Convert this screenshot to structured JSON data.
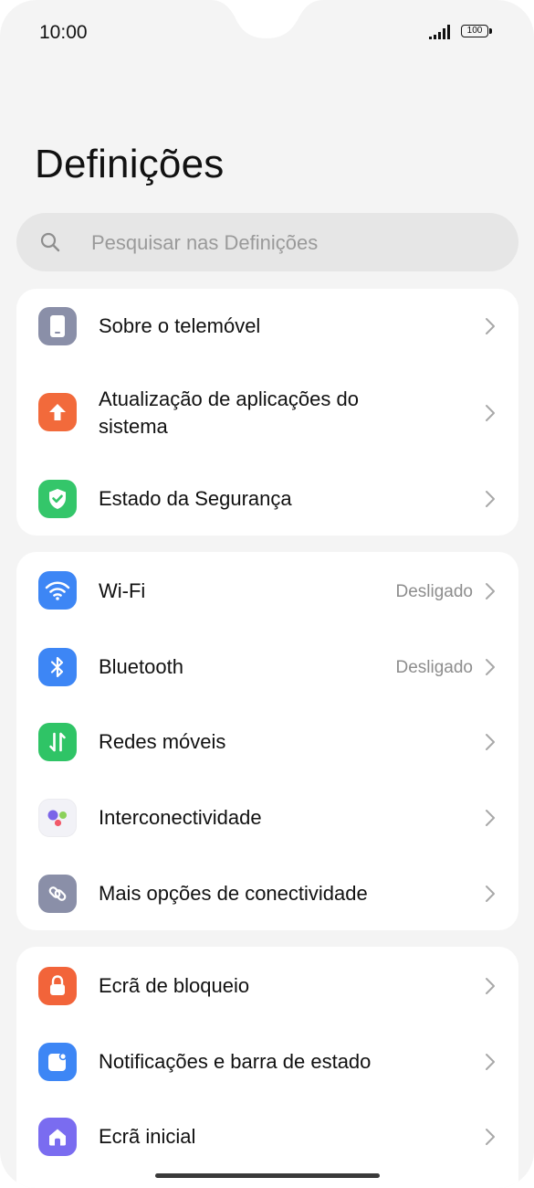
{
  "status_bar": {
    "time": "10:00",
    "battery": "100"
  },
  "page": {
    "title": "Definições"
  },
  "search": {
    "placeholder": "Pesquisar nas Definições"
  },
  "groups": [
    {
      "items": [
        {
          "label": "Sobre o telemóvel",
          "icon": "phone-icon",
          "icon_color": "#8a8fa8"
        },
        {
          "label_line1": "Atualização de aplicações do",
          "label_line2": "sistema",
          "icon": "upload-arrow-icon",
          "icon_color": "#f26a3b"
        },
        {
          "label": "Estado da Segurança",
          "icon": "shield-check-icon",
          "icon_color": "#34c66a"
        }
      ]
    },
    {
      "items": [
        {
          "label": "Wi-Fi",
          "value": "Desligado",
          "icon": "wifi-icon",
          "icon_color": "#3d86f5"
        },
        {
          "label": "Bluetooth",
          "value": "Desligado",
          "icon": "bluetooth-icon",
          "icon_color": "#3d86f5"
        },
        {
          "label": "Redes móveis",
          "icon": "mobile-data-icon",
          "icon_color": "#2fc466"
        },
        {
          "label": "Interconectividade",
          "icon": "interconnect-dots-icon",
          "icon_color": "#f2f2f7"
        },
        {
          "label": "Mais opções de conectividade",
          "icon": "link-icon",
          "icon_color": "#8a8fa8"
        }
      ]
    },
    {
      "items": [
        {
          "label": "Ecrã de bloqueio",
          "icon": "lock-icon",
          "icon_color": "#f2643a"
        },
        {
          "label": "Notificações e barra de estado",
          "icon": "notification-icon",
          "icon_color": "#3d86f5"
        },
        {
          "label": "Ecrã inicial",
          "icon": "home-icon",
          "icon_color": "#7a6cf0"
        }
      ]
    }
  ]
}
